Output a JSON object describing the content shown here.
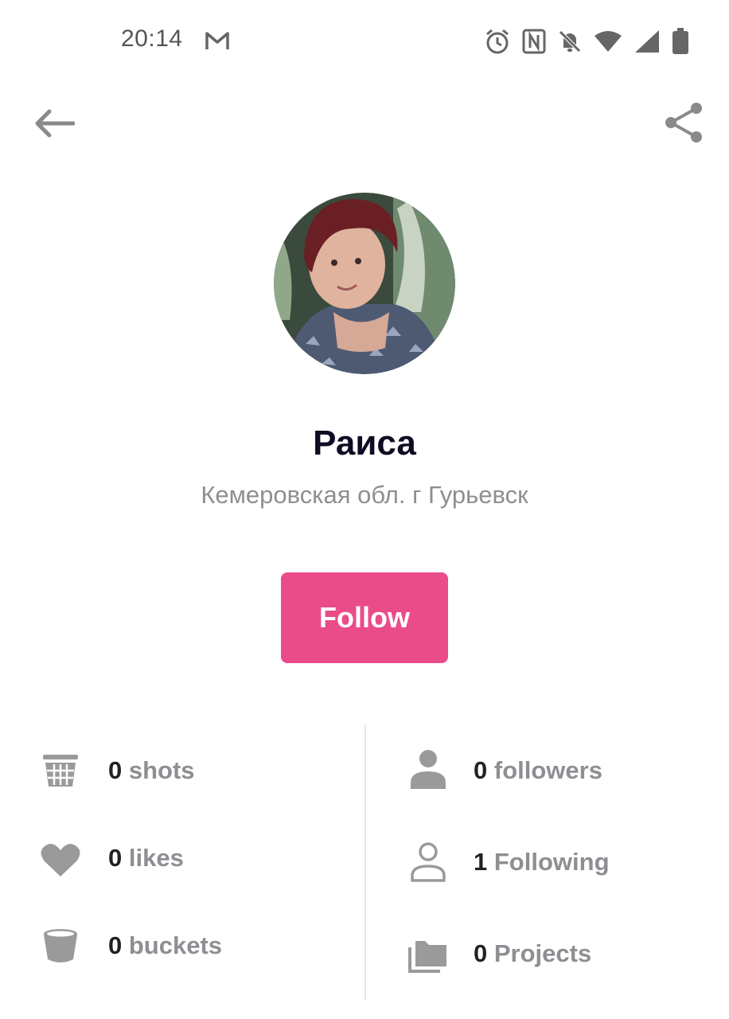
{
  "status_bar": {
    "time": "20:14",
    "icons": [
      "gmail-icon",
      "alarm-icon",
      "nfc-icon",
      "bell-off-icon",
      "wifi-icon",
      "signal-icon",
      "battery-icon"
    ]
  },
  "app_bar": {
    "back_icon": "arrow-left-icon",
    "share_icon": "share-icon"
  },
  "profile": {
    "name": "Раиса",
    "location": "Кемеровская обл. г Гурьевск",
    "follow_label": "Follow"
  },
  "colors": {
    "accent": "#ea4c89",
    "muted": "#8e8e93",
    "icon": "#9a9a9a"
  },
  "stats": {
    "shots": {
      "count": "0",
      "label": "shots"
    },
    "likes": {
      "count": "0",
      "label": "likes"
    },
    "buckets": {
      "count": "0",
      "label": "buckets"
    },
    "followers": {
      "count": "0",
      "label": "followers"
    },
    "following": {
      "count": "1",
      "label": "Following"
    },
    "projects": {
      "count": "0",
      "label": "Projects"
    }
  }
}
